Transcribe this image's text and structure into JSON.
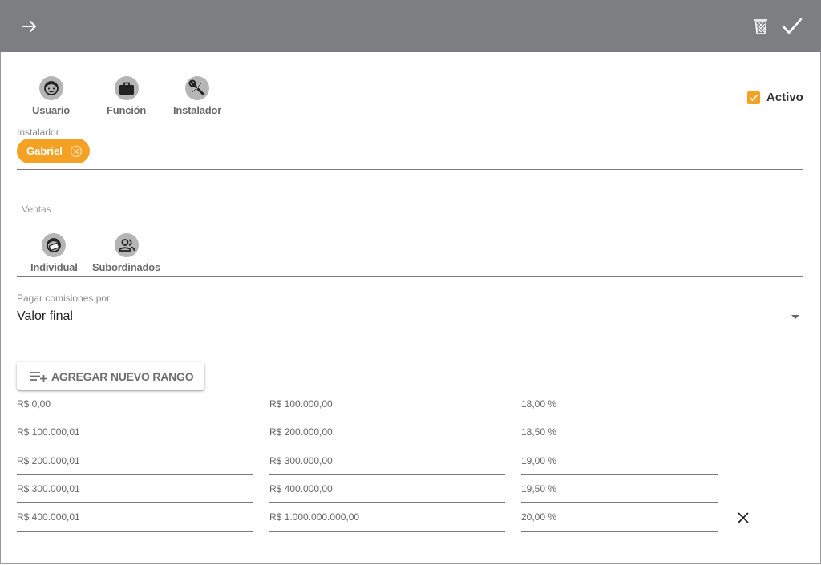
{
  "header": {
    "back_icon": "arrow-right-icon",
    "delete_icon": "trash-icon",
    "confirm_icon": "check-icon",
    "background": "#7d7e81"
  },
  "type_options": [
    {
      "label": "Usuario",
      "icon": "user-face-icon"
    },
    {
      "label": "Función",
      "icon": "briefcase-icon"
    },
    {
      "label": "Instalador",
      "icon": "wrench-screwdriver-icon"
    }
  ],
  "activo": {
    "label": "Activo",
    "checked": true
  },
  "installer_field": {
    "label": "Instalador",
    "chip": "Gabriel"
  },
  "ventas": {
    "label": "Ventas",
    "options": [
      {
        "label": "Individual",
        "icon": "salesperson-icon"
      },
      {
        "label": "Subordinados",
        "icon": "people-icon"
      }
    ]
  },
  "commission_field": {
    "label": "Pagar comisiones por",
    "value": "Valor final"
  },
  "add_range_button": {
    "label": "AGREGAR NUEVO RANGO",
    "icon": "playlist-add-icon"
  },
  "ranges": [
    {
      "from": "R$ 0,00",
      "to": "R$ 100.000,00",
      "percent": "18,00 %"
    },
    {
      "from": "R$ 100.000,01",
      "to": "R$ 200.000,00",
      "percent": "18,50 %"
    },
    {
      "from": "R$ 200.000,01",
      "to": "R$ 300.000,00",
      "percent": "19,00 %"
    },
    {
      "from": "R$ 300.000,01",
      "to": "R$ 400.000,00",
      "percent": "19,50 %"
    },
    {
      "from": "R$ 400.000,01",
      "to": "R$ 1.000.000.000,00",
      "percent": "20,00 %"
    }
  ],
  "colors": {
    "accent": "#f5a124",
    "icon_circle": "#b5b5b5"
  }
}
